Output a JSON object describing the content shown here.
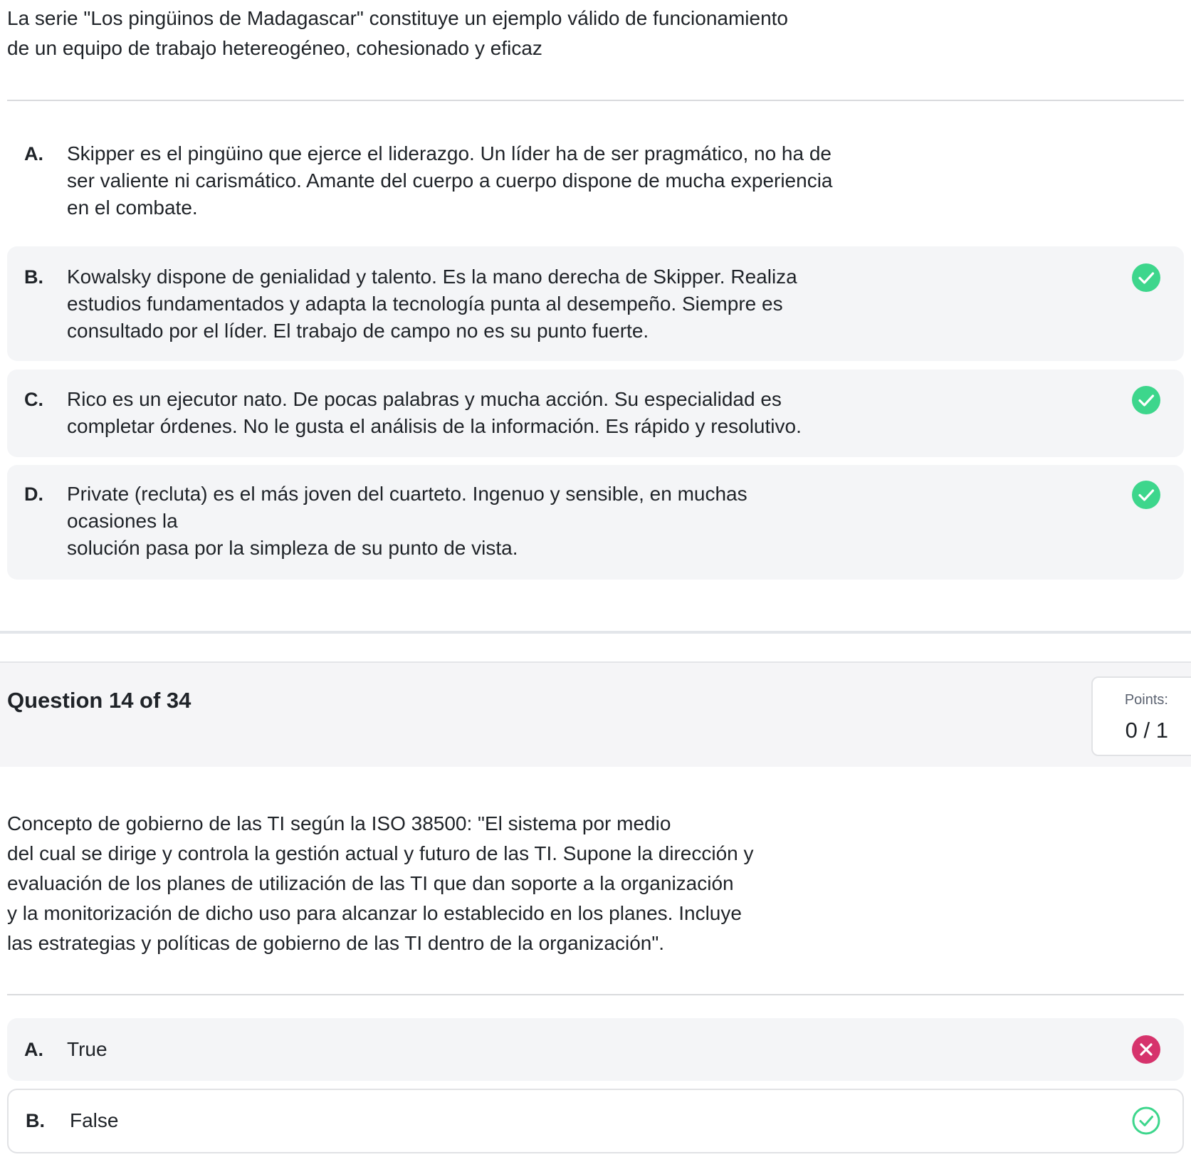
{
  "question13": {
    "prompt_lines": [
      "La serie \"Los pingüinos de Madagascar\" constituye un ejemplo válido de funcionamiento",
      "de un equipo de trabajo hetereogéneo, cohesionado y eficaz"
    ],
    "options": [
      {
        "letter": "A.",
        "lines": [
          "Skipper es el pingüino que ejerce el liderazgo. Un líder ha de ser pragmático, no ha de",
          "ser valiente ni carismático. Amante del cuerpo a cuerpo dispone de mucha experiencia",
          "en el combate."
        ],
        "mark": "none"
      },
      {
        "letter": "B.",
        "lines": [
          "Kowalsky dispone de genialidad y talento. Es la mano derecha de Skipper. Realiza",
          "estudios fundamentados y adapta la tecnología punta al desempeño. Siempre es",
          "consultado por el líder. El trabajo de campo no es su punto fuerte."
        ],
        "mark": "check-filled-icon"
      },
      {
        "letter": "C.",
        "lines": [
          "Rico es un ejecutor nato. De pocas palabras y mucha acción. Su especialidad es",
          "completar órdenes. No le gusta el análisis de la información. Es rápido y resolutivo."
        ],
        "mark": "check-filled-icon"
      },
      {
        "letter": "D.",
        "lines": [
          "Private (recluta) es el más joven del cuarteto. Ingenuo y sensible, en muchas",
          "ocasiones la",
          "solución pasa por la simpleza de su punto de vista."
        ],
        "mark": "check-filled-icon"
      }
    ]
  },
  "question14": {
    "title": "Question 14 of 34",
    "points_label": "Points:",
    "points_value": "0 / 1",
    "prompt_lines": [
      "Concepto de gobierno de las TI según la ISO 38500: \"El sistema por medio",
      "del cual se dirige y controla la gestión actual y futuro de las TI. Supone la dirección y",
      "evaluación de los planes de utilización de las TI que dan soporte a la organización",
      "y la monitorización de dicho uso para alcanzar lo establecido en los planes. Incluye",
      "las estrategias y políticas de gobierno de las TI dentro de la organización\"."
    ],
    "options": [
      {
        "letter": "A.",
        "label": "True",
        "mark": "x-filled-icon"
      },
      {
        "letter": "B.",
        "label": "False",
        "mark": "check-outline-icon"
      }
    ]
  },
  "colors": {
    "correct": "#3dd68c",
    "incorrect": "#d6336c",
    "option_bg": "#f4f5f7",
    "header_bg": "#f5f5f7"
  }
}
